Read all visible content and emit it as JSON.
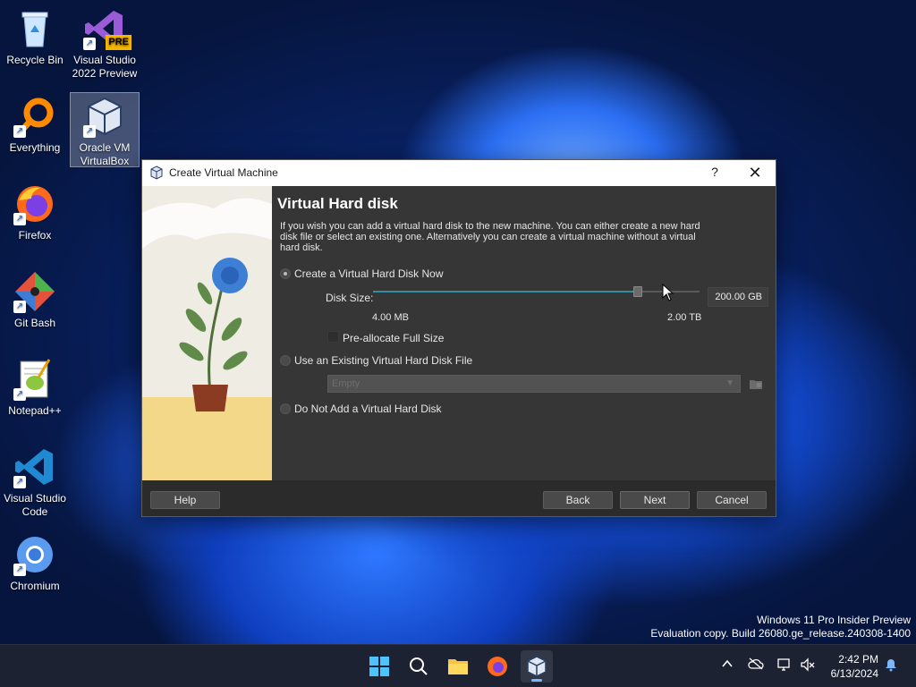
{
  "desktop": {
    "icons": [
      {
        "label": "Recycle Bin"
      },
      {
        "label": "Visual Studio 2022 Preview",
        "line1": "Visual Studio",
        "line2": "2022 Preview",
        "badge": "PRE"
      },
      {
        "label": "Everything"
      },
      {
        "label": "Oracle VM VirtualBox",
        "line1": "Oracle VM",
        "line2": "VirtualBox"
      },
      {
        "label": "Firefox"
      },
      {
        "label": "Git Bash"
      },
      {
        "label": "Notepad++"
      },
      {
        "label": "Visual Studio Code",
        "line1": "Visual Studio",
        "line2": "Code"
      },
      {
        "label": "Chromium"
      }
    ],
    "watermark_line1": "Windows 11 Pro Insider Preview",
    "watermark_line2": "Evaluation copy. Build 26080.ge_release.240308-1400"
  },
  "dialog": {
    "title": "Create Virtual Machine",
    "help_glyph": "?",
    "close_glyph": "✕",
    "heading": "Virtual Hard disk",
    "description": "If you wish you can add a virtual hard disk to the new machine. You can either create a new hard disk file or select an existing one. Alternatively you can create a virtual machine without a virtual hard disk.",
    "option_create": "Create a Virtual Hard Disk Now",
    "disk_size_label": "Disk Size:",
    "disk_size_value": "200.00 GB",
    "slider_fraction": 0.81,
    "min_label": "4.00 MB",
    "max_label": "2.00 TB",
    "preallocate_label": "Pre-allocate Full Size",
    "option_existing": "Use an Existing Virtual Hard Disk File",
    "existing_placeholder": "Empty",
    "option_none": "Do Not Add a Virtual Hard Disk",
    "buttons": {
      "help": "Help",
      "back": "Back",
      "next": "Next",
      "cancel": "Cancel"
    }
  },
  "taskbar": {
    "time": "2:42 PM",
    "date": "6/13/2024"
  },
  "colors": {
    "accent": "#2f8ea0",
    "dialog_bg": "#363636",
    "taskbar_bg": "#1c2232"
  }
}
